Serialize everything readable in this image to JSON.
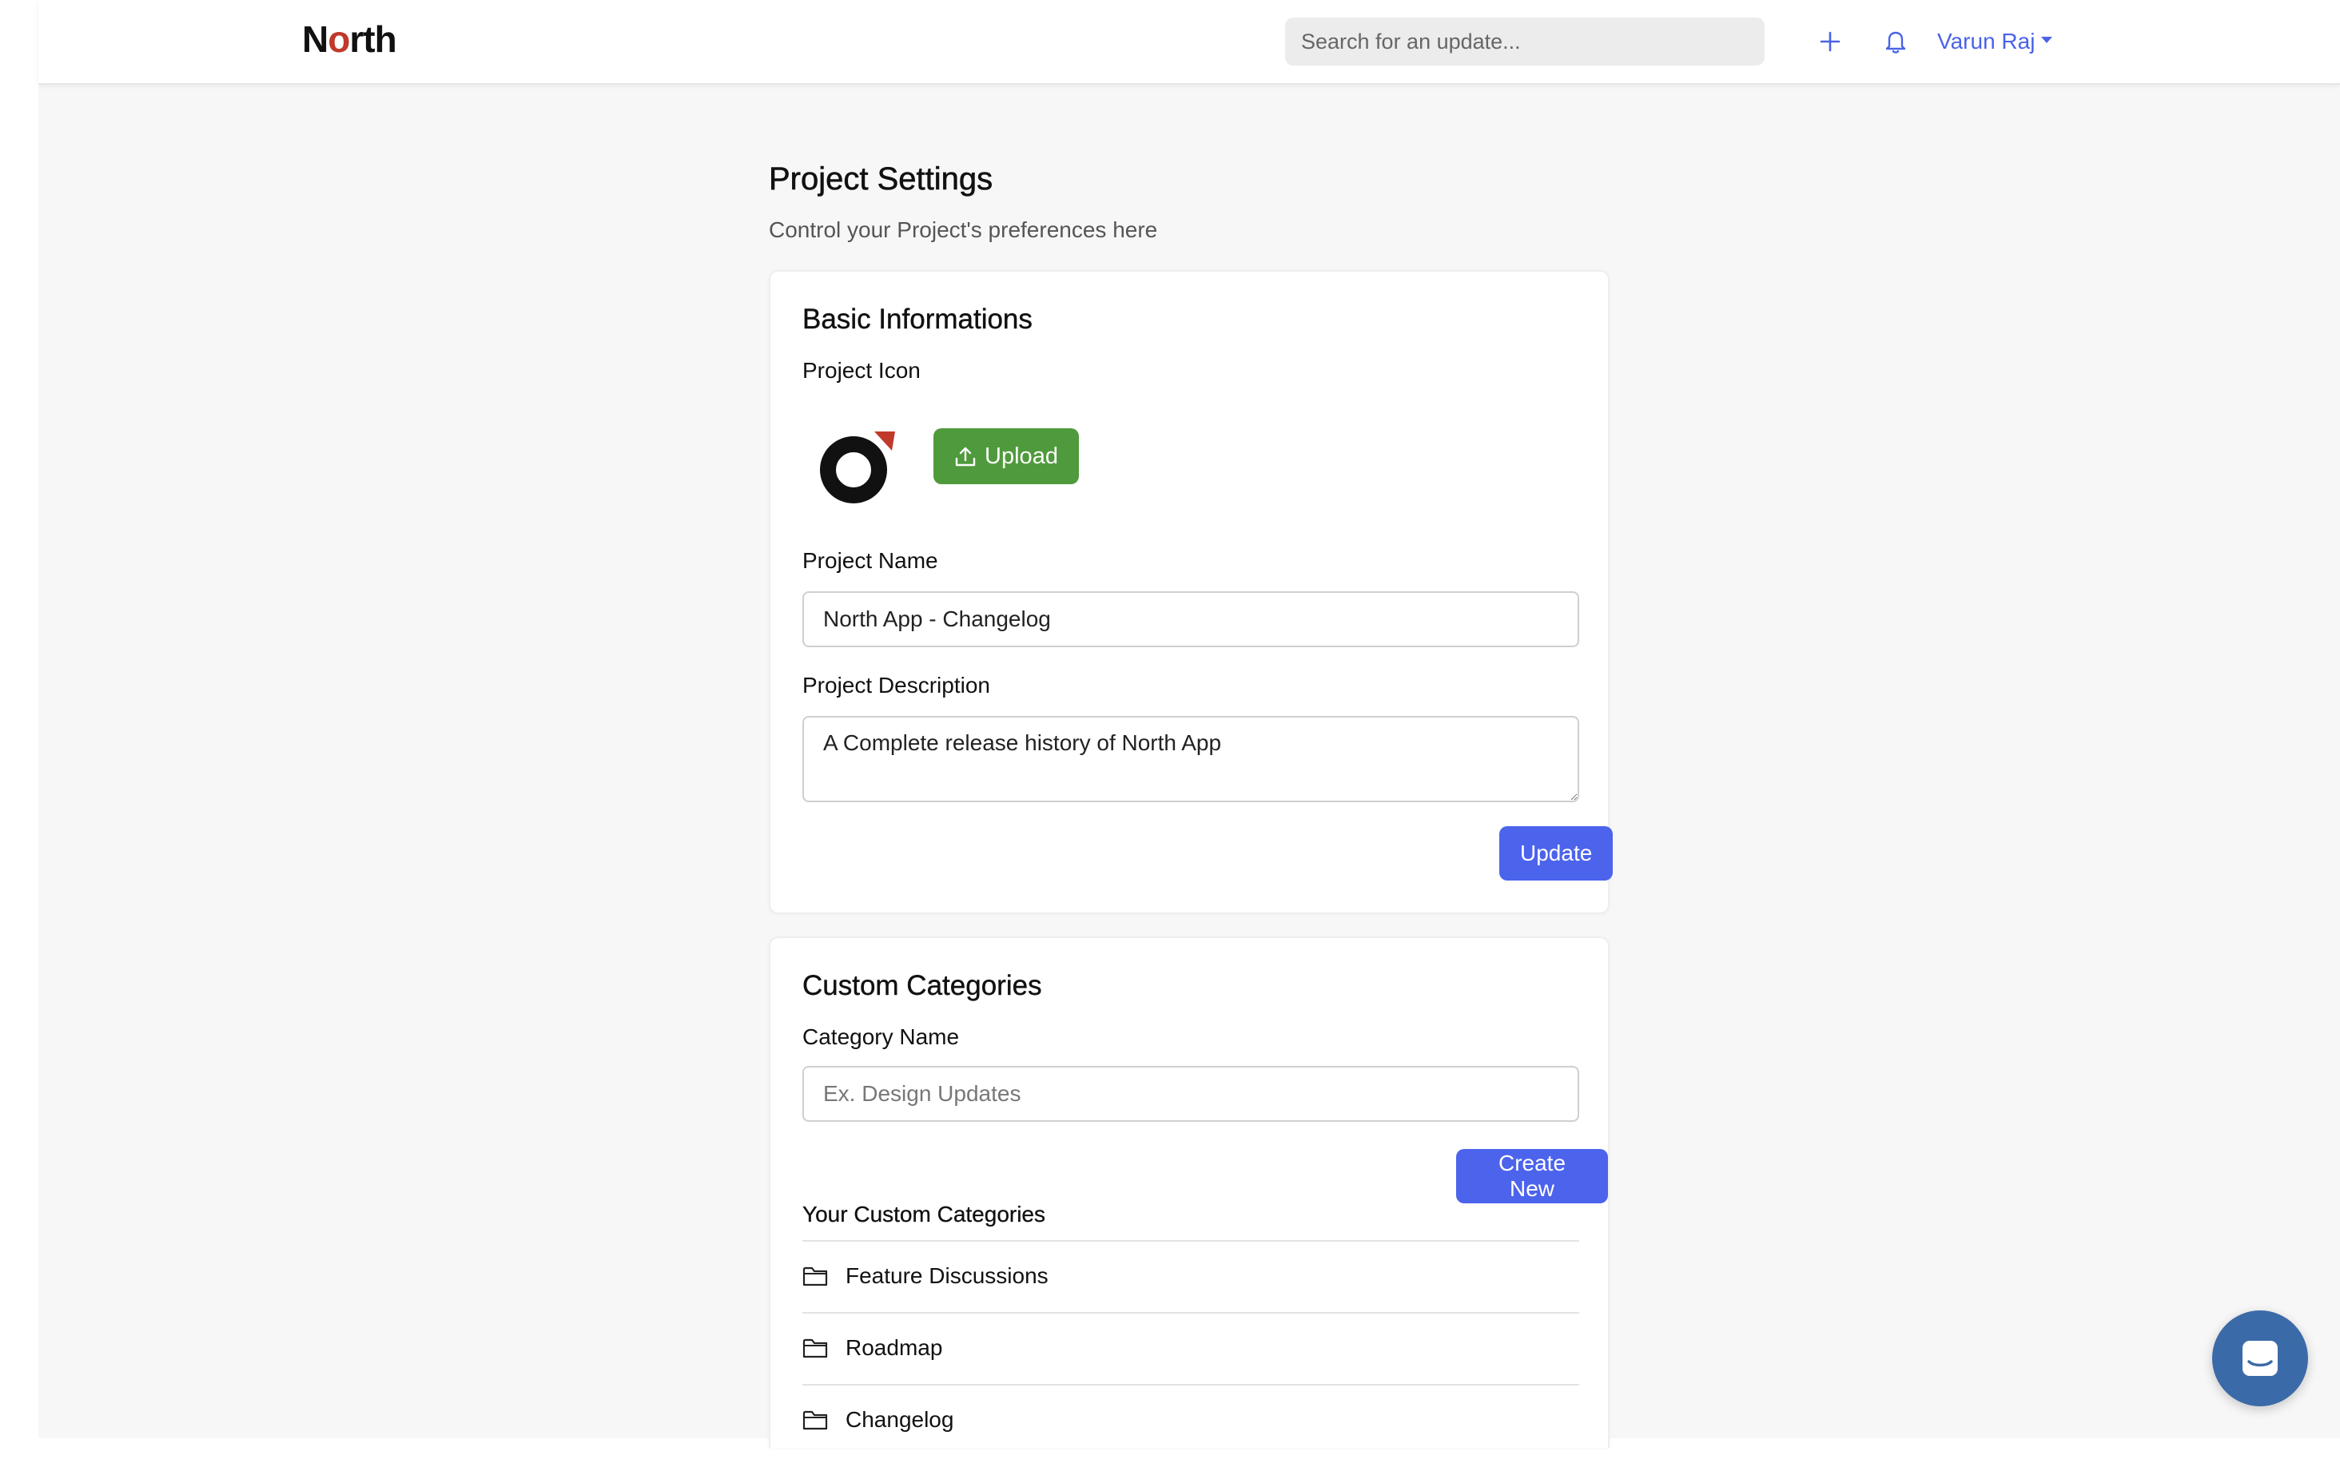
{
  "header": {
    "logo_text_prefix": "N",
    "logo_text_o": "o",
    "logo_text_suffix": "rth",
    "search_placeholder": "Search for an update...",
    "user_name": "Varun Raj",
    "accent_color": "#4a63e7",
    "icons": [
      "plus-icon",
      "bell-icon"
    ]
  },
  "page": {
    "title": "Project Settings",
    "subtitle": "Control your Project's preferences here"
  },
  "basic_info": {
    "title": "Basic Informations",
    "icon_label": "Project Icon",
    "upload_label": "Upload",
    "name_label": "Project Name",
    "name_value": "North App - Changelog",
    "description_label": "Project Description",
    "description_value": "A Complete release history of North App",
    "update_label": "Update"
  },
  "custom_categories": {
    "title": "Custom Categories",
    "category_name_label": "Category Name",
    "category_name_placeholder": "Ex. Design Updates",
    "create_label": "Create New",
    "list_title": "Your Custom Categories",
    "items": [
      {
        "label": "Feature Discussions",
        "icon": "folder-icon"
      },
      {
        "label": "Roadmap",
        "icon": "folder-icon"
      },
      {
        "label": "Changelog",
        "icon": "folder-icon"
      }
    ]
  },
  "colors": {
    "primary_button": "#4c63ec",
    "upload_button": "#4f9a3c",
    "chat_bubble": "#3b6aa8",
    "logo_accent": "#c0392b"
  }
}
